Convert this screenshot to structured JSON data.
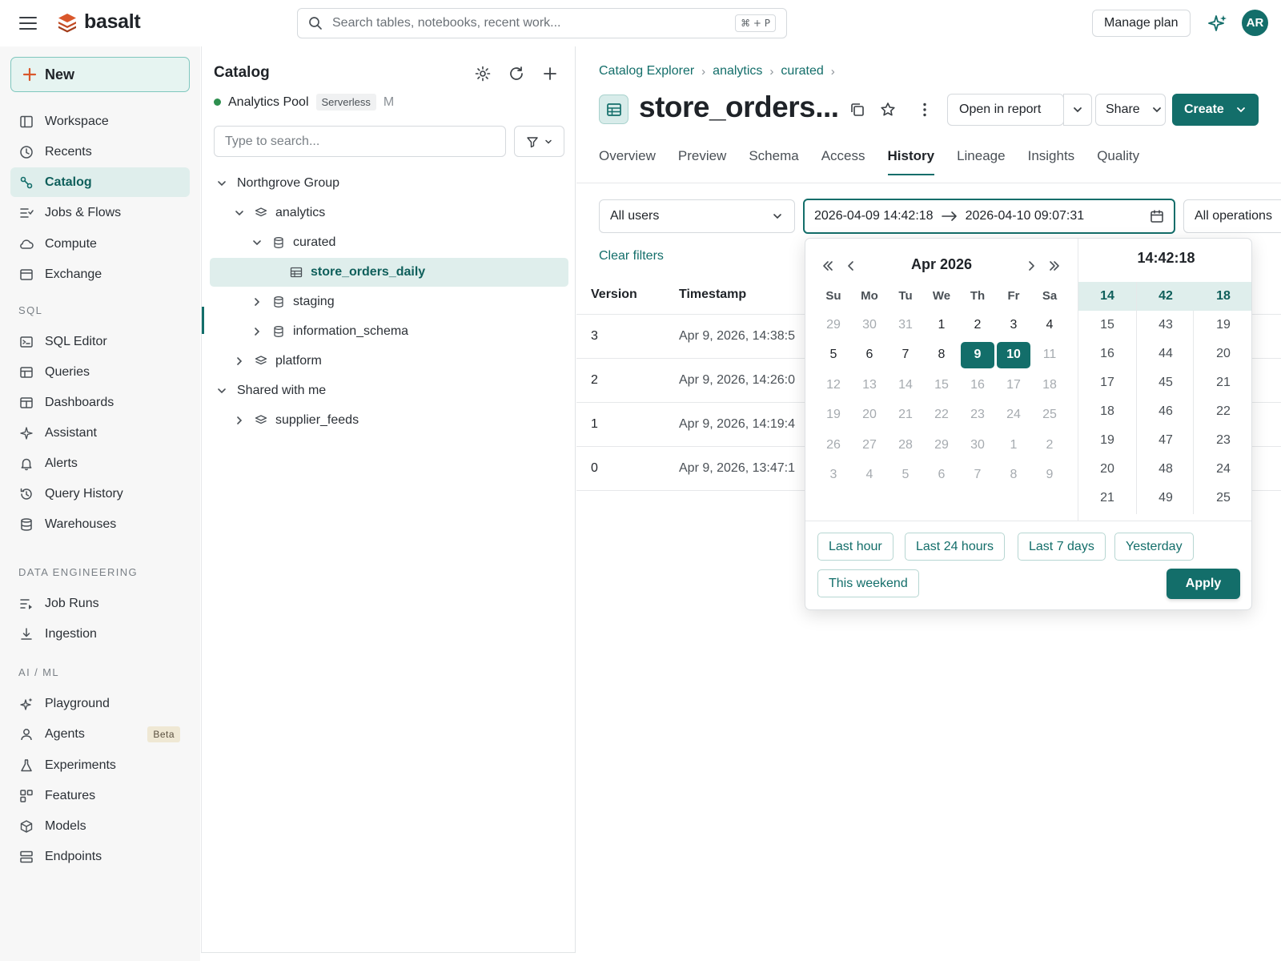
{
  "app": {
    "name": "basalt"
  },
  "topbar": {
    "search_placeholder": "Search tables, notebooks, recent work...",
    "search_shortcut": "⌘ + P",
    "manage_plan": "Manage plan",
    "avatar_initials": "AR"
  },
  "sidebar": {
    "new_label": "New",
    "items_main": [
      {
        "label": "Workspace",
        "icon": "workspace-icon"
      },
      {
        "label": "Recents",
        "icon": "clock-icon"
      },
      {
        "label": "Catalog",
        "icon": "catalog-icon",
        "active": true
      },
      {
        "label": "Jobs & Flows",
        "icon": "jobs-icon"
      },
      {
        "label": "Compute",
        "icon": "cloud-icon"
      },
      {
        "label": "Exchange",
        "icon": "exchange-icon"
      }
    ],
    "section_sql": "SQL",
    "items_sql": [
      {
        "label": "SQL Editor",
        "icon": "terminal-icon"
      },
      {
        "label": "Queries",
        "icon": "queries-icon"
      },
      {
        "label": "Dashboards",
        "icon": "dashboard-icon"
      },
      {
        "label": "Assistant",
        "icon": "sparkle-icon"
      },
      {
        "label": "Alerts",
        "icon": "bell-icon"
      },
      {
        "label": "Query History",
        "icon": "history-icon"
      },
      {
        "label": "Warehouses",
        "icon": "database-icon"
      }
    ],
    "section_data_eng": "DATA ENGINEERING",
    "items_data_eng": [
      {
        "label": "Job Runs",
        "icon": "job-runs-icon"
      },
      {
        "label": "Ingestion",
        "icon": "download-icon"
      }
    ],
    "section_ai": "AI / ML",
    "items_ai": [
      {
        "label": "Playground",
        "icon": "sparkles-icon"
      },
      {
        "label": "Agents",
        "icon": "user-icon",
        "badge": "Beta"
      },
      {
        "label": "Experiments",
        "icon": "flask-icon"
      },
      {
        "label": "Features",
        "icon": "features-icon"
      },
      {
        "label": "Models",
        "icon": "cube-icon"
      },
      {
        "label": "Endpoints",
        "icon": "server-icon"
      }
    ]
  },
  "catalog": {
    "title": "Catalog",
    "pool_name": "Analytics Pool",
    "pool_tag": "Serverless",
    "pool_extra": "M",
    "search_placeholder": "Type to search...",
    "tree": [
      {
        "label": "Northgrove Group",
        "depth": 0,
        "expanded": true,
        "icon": ""
      },
      {
        "label": "analytics",
        "depth": 1,
        "expanded": true,
        "icon": "schema-icon"
      },
      {
        "label": "curated",
        "depth": 2,
        "expanded": true,
        "icon": "database-icon"
      },
      {
        "label": "store_orders_daily",
        "depth": 3,
        "icon": "table-icon",
        "selected": true
      },
      {
        "label": "staging",
        "depth": 2,
        "expanded": false,
        "icon": "database-icon"
      },
      {
        "label": "information_schema",
        "depth": 2,
        "expanded": false,
        "icon": "database-icon"
      },
      {
        "label": "platform",
        "depth": 1,
        "expanded": false,
        "icon": "schema-icon"
      },
      {
        "label": "Shared with me",
        "depth": 0,
        "expanded": true,
        "icon": ""
      },
      {
        "label": "supplier_feeds",
        "depth": 1,
        "expanded": false,
        "icon": "schema-icon"
      }
    ]
  },
  "main": {
    "breadcrumbs": [
      "Catalog Explorer",
      "analytics",
      "curated"
    ],
    "title": "store_orders...",
    "open_in_report": "Open in report",
    "share": "Share",
    "create": "Create",
    "tabs": [
      "Overview",
      "Preview",
      "Schema",
      "Access",
      "History",
      "Lineage",
      "Insights",
      "Quality"
    ],
    "active_tab": "History",
    "filter_users": "All users",
    "date_from": "2026-04-09 14:42:18",
    "date_to": "2026-04-10 09:07:31",
    "filter_ops": "All operations",
    "clear_filters": "Clear filters",
    "columns": [
      "Version",
      "Timestamp"
    ],
    "rows": [
      {
        "version": "3",
        "timestamp": "Apr 9, 2026, 14:38:5"
      },
      {
        "version": "2",
        "timestamp": "Apr 9, 2026, 14:26:0"
      },
      {
        "version": "1",
        "timestamp": "Apr 9, 2026, 14:19:4"
      },
      {
        "version": "0",
        "timestamp": "Apr 9, 2026, 13:47:1"
      }
    ]
  },
  "picker": {
    "month_label": "Apr 2026",
    "weekdays": [
      "Su",
      "Mo",
      "Tu",
      "We",
      "Th",
      "Fr",
      "Sa"
    ],
    "weeks": [
      [
        [
          "29",
          "out"
        ],
        [
          "30",
          "out"
        ],
        [
          "31",
          "out"
        ],
        [
          "1",
          "in"
        ],
        [
          "2",
          "in"
        ],
        [
          "3",
          "in"
        ],
        [
          "4",
          "in"
        ]
      ],
      [
        [
          "5",
          "in"
        ],
        [
          "6",
          "in"
        ],
        [
          "7",
          "in"
        ],
        [
          "8",
          "in"
        ],
        [
          "9",
          "sel"
        ],
        [
          "10",
          "range"
        ],
        [
          "11",
          "out"
        ]
      ],
      [
        [
          "12",
          "out"
        ],
        [
          "13",
          "out"
        ],
        [
          "14",
          "out"
        ],
        [
          "15",
          "out"
        ],
        [
          "16",
          "out"
        ],
        [
          "17",
          "out"
        ],
        [
          "18",
          "out"
        ]
      ],
      [
        [
          "19",
          "out"
        ],
        [
          "20",
          "out"
        ],
        [
          "21",
          "out"
        ],
        [
          "22",
          "out"
        ],
        [
          "23",
          "out"
        ],
        [
          "24",
          "out"
        ],
        [
          "25",
          "out"
        ]
      ],
      [
        [
          "26",
          "out"
        ],
        [
          "27",
          "out"
        ],
        [
          "28",
          "out"
        ],
        [
          "29",
          "out"
        ],
        [
          "30",
          "out"
        ],
        [
          "1",
          "out"
        ],
        [
          "2",
          "out"
        ]
      ],
      [
        [
          "3",
          "out"
        ],
        [
          "4",
          "out"
        ],
        [
          "5",
          "out"
        ],
        [
          "6",
          "out"
        ],
        [
          "7",
          "out"
        ],
        [
          "8",
          "out"
        ],
        [
          "9",
          "out"
        ]
      ]
    ],
    "time_label": "14:42:18",
    "hours": [
      "14",
      "15",
      "16",
      "17",
      "18",
      "19",
      "20",
      "21"
    ],
    "minutes": [
      "42",
      "43",
      "44",
      "45",
      "46",
      "47",
      "48",
      "49"
    ],
    "seconds": [
      "18",
      "19",
      "20",
      "21",
      "22",
      "23",
      "24",
      "25"
    ],
    "presets_row1": [
      "Last hour",
      "Last 24 hours",
      "Last 7 days",
      "Yesterday"
    ],
    "presets_row2": [
      "This weekend"
    ],
    "apply": "Apply"
  },
  "colors": {
    "accent": "#136e6a",
    "accent_light": "#dfeeec",
    "logo": "#d9572b"
  }
}
